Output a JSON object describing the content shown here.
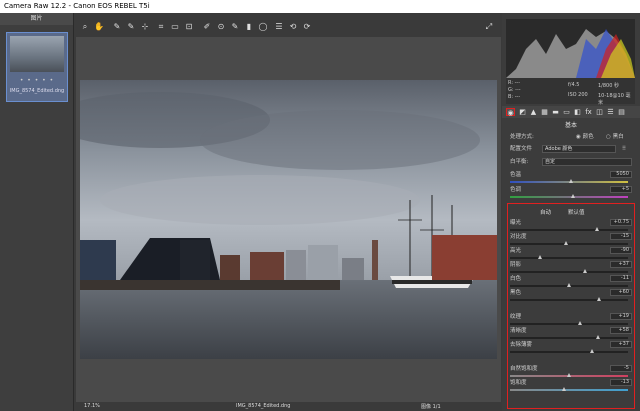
{
  "window": {
    "title": "Camera Raw 12.2  -  Canon EOS REBEL T5i"
  },
  "filmstrip": {
    "header": "图片",
    "stars": "• • • • •",
    "filename": "IMG_8574_Edited.dng"
  },
  "toolbar": {
    "icons": [
      "zoom-icon",
      "hand-icon",
      "white-balance-icon",
      "color-sampler-icon",
      "target-adjust-icon",
      "crop-icon",
      "straighten-icon",
      "transform-icon",
      "spot-removal-icon",
      "red-eye-icon",
      "adjustment-brush-icon",
      "graduated-filter-icon",
      "radial-filter-icon",
      "preferences-icon",
      "rotate-ccw-icon",
      "rotate-cw-icon"
    ]
  },
  "statusbar": {
    "zoom": "17.1%",
    "filename": "IMG_8574_Edited.dng",
    "counter": "图像 1/1"
  },
  "histogram": {
    "meta_r": "R: ---",
    "meta_g": "G: ---",
    "meta_b": "B: ---",
    "aperture": "f/4.5",
    "shutter": "1/800 秒",
    "iso": "ISO 200",
    "lens": "10-18@10 毫米"
  },
  "panel": {
    "title": "基本",
    "process_label": "处理方式:",
    "process_color": "颜色",
    "process_bw": "黑白",
    "profile_label": "配置文件",
    "profile_value": "Adobe 颜色",
    "wb_label": "白平衡:",
    "wb_value": "自定",
    "temp_label": "色温",
    "temp_value": "5050",
    "tint_label": "色调",
    "tint_value": "+5",
    "auto": "自动",
    "default": "默认值",
    "sliders": [
      {
        "label": "曝光",
        "value": "+0.75"
      },
      {
        "label": "对比度",
        "value": "-15"
      },
      {
        "label": "高光",
        "value": "-90"
      },
      {
        "label": "阴影",
        "value": "+37"
      },
      {
        "label": "白色",
        "value": "-11"
      },
      {
        "label": "黑色",
        "value": "+60"
      },
      {
        "label": "纹理",
        "value": "+19"
      },
      {
        "label": "清晰度",
        "value": "+58"
      },
      {
        "label": "去除薄雾",
        "value": "+37"
      },
      {
        "label": "自然饱和度",
        "value": "-5"
      },
      {
        "label": "饱和度",
        "value": "-13"
      }
    ]
  }
}
